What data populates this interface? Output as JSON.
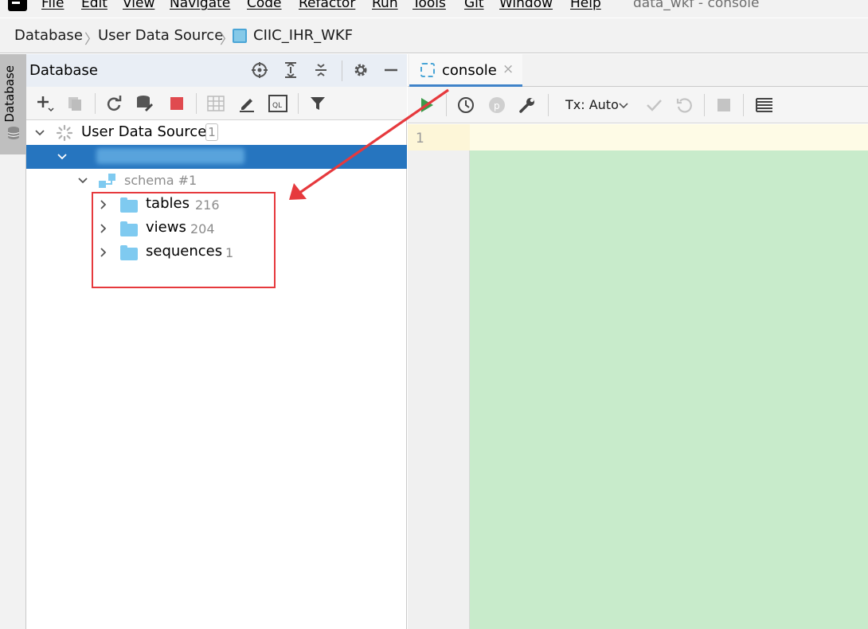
{
  "menu": {
    "items": [
      "File",
      "Edit",
      "View",
      "Navigate",
      "Code",
      "Refactor",
      "Run",
      "Tools",
      "Git",
      "Window",
      "Help"
    ],
    "window_title": "data_wkf - console"
  },
  "breadcrumb": {
    "items": [
      "Database",
      "User Data Source",
      "CIIC_IHR_WKF"
    ]
  },
  "left_strip": {
    "tab_label": "Database"
  },
  "database_panel": {
    "title": "Database",
    "tree": {
      "root_label": "User Data Source",
      "root_count": "1",
      "schema_label": "schema #1",
      "folders": [
        {
          "label": "tables",
          "count": "216"
        },
        {
          "label": "views",
          "count": "204"
        },
        {
          "label": "sequences",
          "count": "1"
        }
      ]
    }
  },
  "console": {
    "tab_label": "console",
    "tab_close": "×",
    "tx_mode": "Tx: Auto",
    "line_number": "1"
  },
  "colors": {
    "selection": "#2675bf",
    "annotation": "#e6393d",
    "editor_bg": "#c8ebcb",
    "folder": "#7fcaf0"
  }
}
